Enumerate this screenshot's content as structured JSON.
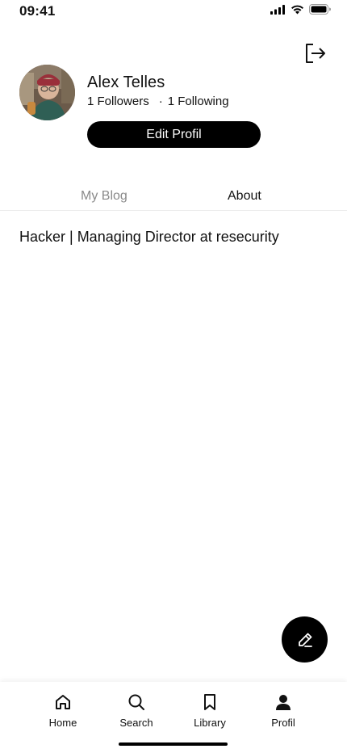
{
  "status_bar": {
    "time": "09:41",
    "icons": [
      "signal-icon",
      "wifi-icon",
      "battery-icon"
    ]
  },
  "header": {
    "logout_icon": "logout-icon"
  },
  "profile": {
    "name": "Alex Telles",
    "followers": "1 Followers",
    "separator": "·",
    "following": "1 Following",
    "edit_label": "Edit Profil"
  },
  "tabs": [
    {
      "label": "My Blog",
      "active": false
    },
    {
      "label": "About",
      "active": true
    }
  ],
  "about": {
    "bio": "Hacker | Managing Director at resecurity"
  },
  "fab": {
    "icon": "pencil-icon"
  },
  "bottom_nav": [
    {
      "label": "Home",
      "icon": "home-icon"
    },
    {
      "label": "Search",
      "icon": "search-icon"
    },
    {
      "label": "Library",
      "icon": "bookmark-icon"
    },
    {
      "label": "Profil",
      "icon": "person-icon"
    }
  ],
  "colors": {
    "primary": "#000000",
    "background": "#ffffff",
    "inactive_tab": "#8a8a8a",
    "divider": "#ececec"
  }
}
